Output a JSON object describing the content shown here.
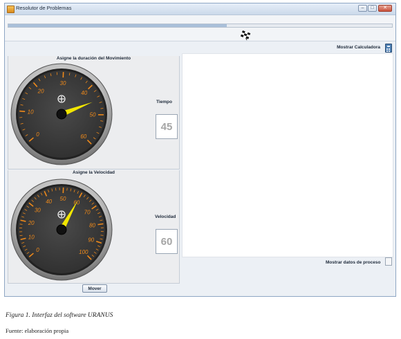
{
  "window": {
    "title": "Resolutor de Problemas",
    "progress": 0.57
  },
  "toolbar": {
    "calc_label": "Mostrar Calculadora"
  },
  "panel_duration": {
    "title": "Asigne la duración del Movimiento",
    "gauge": {
      "ticks": [
        "0",
        "10",
        "20",
        "30",
        "40",
        "50",
        "60"
      ],
      "min": 0,
      "max": 60,
      "needle_value": 45
    },
    "label": "Tiempo",
    "value": "45"
  },
  "panel_velocity": {
    "title": "Asigne la Velocidad",
    "gauge": {
      "ticks": [
        "0",
        "10",
        "20",
        "30",
        "40",
        "50",
        "60",
        "70",
        "80",
        "90",
        "100"
      ],
      "min": 0,
      "max": 100,
      "needle_value": 60
    },
    "label": "Velocidad",
    "value": "60"
  },
  "process": {
    "label": "Mostrar datos de proceso",
    "checked": false
  },
  "actions": {
    "mover_label": "Mover"
  },
  "figure": {
    "caption": "Figura 1. Interfaz del software URANUS",
    "source": "Fuente: elaboración propia"
  },
  "colors": {
    "needle": "#f2e600",
    "tick_label": "#f08a1a",
    "gauge_face": "#2f2f2f"
  }
}
